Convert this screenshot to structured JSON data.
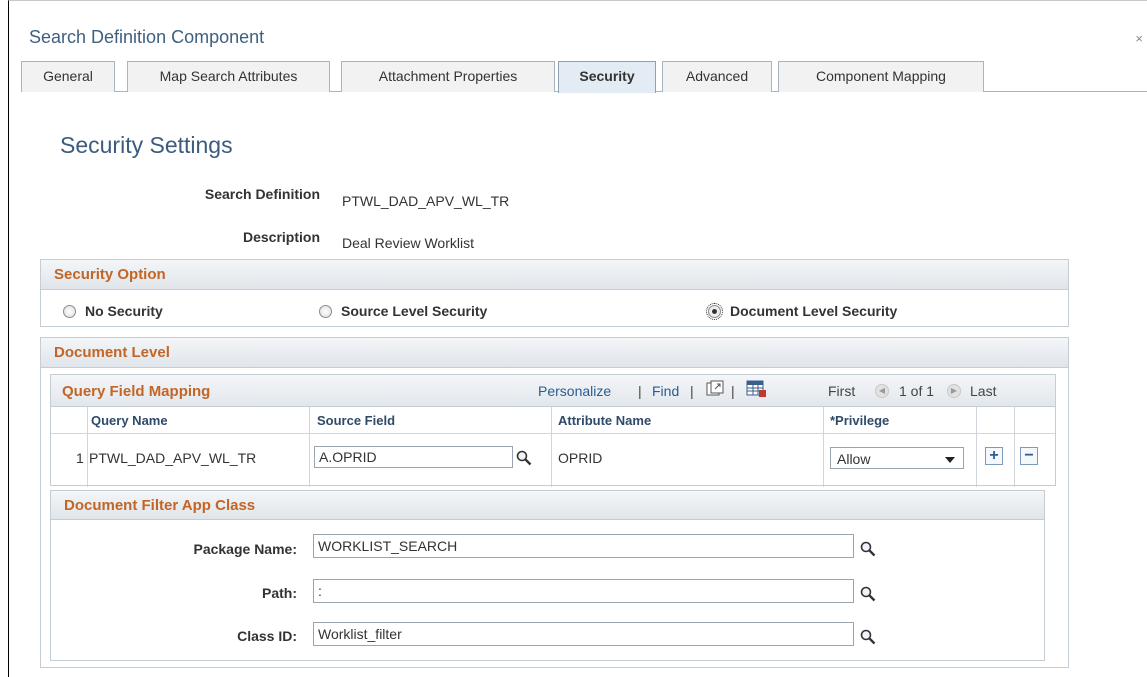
{
  "window": {
    "title": "Search Definition Component",
    "close_label": "×"
  },
  "tabs": [
    {
      "label": "General"
    },
    {
      "label": "Map Search Attributes"
    },
    {
      "label": "Attachment Properties"
    },
    {
      "label": "Security"
    },
    {
      "label": "Advanced"
    },
    {
      "label": "Component Mapping"
    }
  ],
  "page": {
    "title": "Security Settings",
    "search_definition_label": "Search Definition",
    "search_definition_value": "PTWL_DAD_APV_WL_TR",
    "description_label": "Description",
    "description_value": "Deal Review Worklist"
  },
  "security_option": {
    "header": "Security Option",
    "options": [
      {
        "label": "No Security",
        "checked": false
      },
      {
        "label": "Source Level Security",
        "checked": false
      },
      {
        "label": "Document Level Security",
        "checked": true
      }
    ]
  },
  "document_level": {
    "header": "Document Level",
    "grid": {
      "title": "Query Field Mapping",
      "personalize": "Personalize",
      "find": "Find",
      "separator": "|",
      "first": "First",
      "range": "1 of 1",
      "last": "Last",
      "columns": [
        "Query Name",
        "Source Field",
        "Attribute Name",
        "*Privilege"
      ],
      "rows": [
        {
          "num": "1",
          "query_name": "PTWL_DAD_APV_WL_TR",
          "source_field": "A.OPRID",
          "attribute_name": "OPRID",
          "privilege": "Allow"
        }
      ],
      "add_label": "+",
      "remove_label": "−"
    },
    "filter": {
      "header": "Document Filter App Class",
      "package_label": "Package Name:",
      "package_value": "WORKLIST_SEARCH",
      "path_label": "Path:",
      "path_value": ":",
      "class_label": "Class ID:",
      "class_value": "Worklist_filter"
    }
  },
  "colors": {
    "accent_orange": "#c26525",
    "title_blue": "#3c5b7e",
    "link_blue": "#2a5c8f"
  }
}
